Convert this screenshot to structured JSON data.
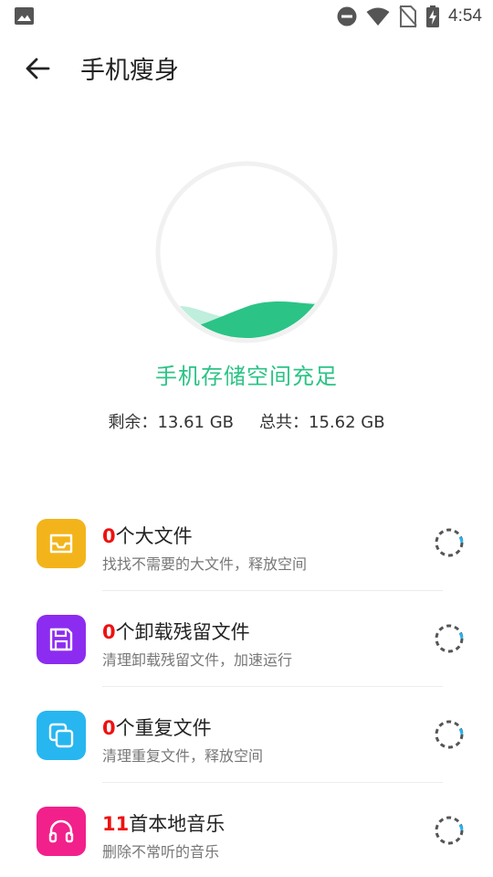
{
  "status_bar": {
    "time": "4:54",
    "icons": [
      "image-icon",
      "do-not-disturb-icon",
      "wifi-icon",
      "no-sim-icon",
      "battery-charging-icon"
    ]
  },
  "app_bar": {
    "title": "手机瘦身",
    "back_icon": "arrow-back-icon"
  },
  "storage": {
    "status": "手机存储空间充足",
    "remaining_label": "剩余：",
    "remaining_value": "13.61 GB",
    "total_label": "总共：",
    "total_value": "15.62 GB",
    "accent_color": "#2cc386"
  },
  "items": [
    {
      "count": "0",
      "title": "个大文件",
      "subtitle": "找找不需要的大文件，释放空间",
      "icon": "inbox-icon",
      "color": "#f3b41b"
    },
    {
      "count": "0",
      "title": "个卸载残留文件",
      "subtitle": "清理卸载残留文件，加速运行",
      "icon": "save-icon",
      "color": "#8c2cf0"
    },
    {
      "count": "0",
      "title": "个重复文件",
      "subtitle": "清理重复文件，释放空间",
      "icon": "copy-icon",
      "color": "#27b6f0"
    },
    {
      "count": "11",
      "title": "首本地音乐",
      "subtitle": "删除不常听的音乐",
      "icon": "headphones-icon",
      "color": "#f2208b"
    }
  ]
}
